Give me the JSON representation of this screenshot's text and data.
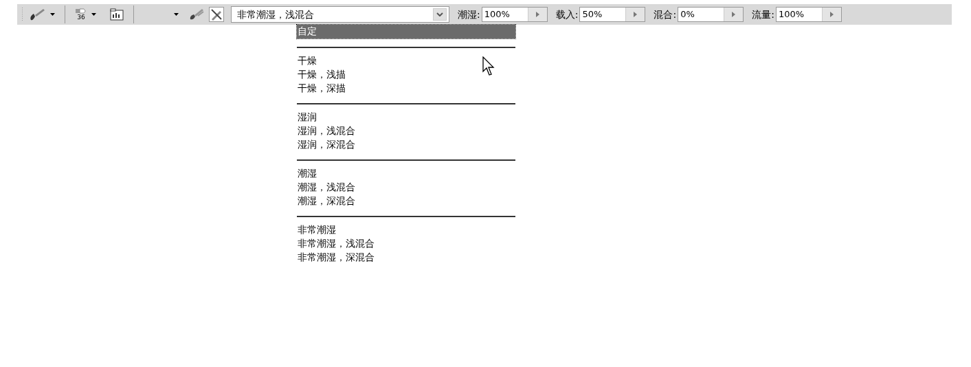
{
  "toolbar": {
    "brush_size": "36",
    "mode": {
      "value": "非常潮湿，浅混合"
    },
    "fields": [
      {
        "label": "潮湿:",
        "value": "100%"
      },
      {
        "label": "载入:",
        "value": "50%"
      },
      {
        "label": "混合:",
        "value": "0%"
      },
      {
        "label": "流量:",
        "value": "100%"
      }
    ]
  },
  "dropdown": {
    "groups": [
      {
        "items": [
          {
            "label": "自定",
            "selected": true
          }
        ]
      },
      {
        "items": [
          {
            "label": "干燥",
            "selected": false
          },
          {
            "label": "干燥，浅描",
            "selected": false
          },
          {
            "label": "干燥，深描",
            "selected": false
          }
        ]
      },
      {
        "items": [
          {
            "label": "湿润",
            "selected": false
          },
          {
            "label": "湿润，浅混合",
            "selected": false
          },
          {
            "label": "湿润，深混合",
            "selected": false
          }
        ]
      },
      {
        "items": [
          {
            "label": "潮湿",
            "selected": false
          },
          {
            "label": "潮湿，浅混合",
            "selected": false
          },
          {
            "label": "潮湿，深混合",
            "selected": false
          }
        ]
      },
      {
        "items": [
          {
            "label": "非常潮湿",
            "selected": false
          },
          {
            "label": "非常潮湿，浅混合",
            "selected": false
          },
          {
            "label": "非常潮湿，深混合",
            "selected": false
          }
        ]
      }
    ]
  }
}
